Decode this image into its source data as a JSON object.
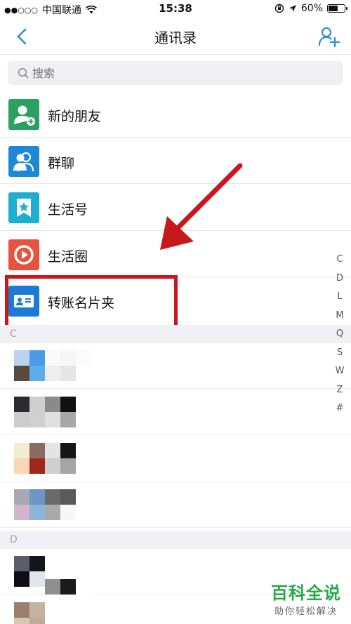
{
  "status_bar": {
    "signal": "●●○○○",
    "carrier": "中国联通",
    "time": "15:38",
    "battery_percent": "60%",
    "battery_level": 0.6
  },
  "nav": {
    "title": "通讯录"
  },
  "search": {
    "placeholder": "搜索"
  },
  "menu": [
    {
      "label": "新的朋友",
      "icon": "new-friend-icon",
      "color": "#2ba05f"
    },
    {
      "label": "群聊",
      "icon": "group-chat-icon",
      "color": "#1e88d8"
    },
    {
      "label": "生活号",
      "icon": "life-account-icon",
      "color": "#1eaed0"
    },
    {
      "label": "生活圈",
      "icon": "life-circle-icon",
      "color": "#e8533f"
    },
    {
      "label": "转账名片夹",
      "icon": "business-card-icon",
      "color": "#1b7bd6"
    }
  ],
  "sections": [
    {
      "letter": "C"
    },
    {
      "letter": "D"
    }
  ],
  "index_letters": [
    "C",
    "D",
    "L",
    "M",
    "Q",
    "S",
    "W",
    "Z",
    "#"
  ],
  "watermark": {
    "main": "百科全说",
    "sub": "助你轻松解决"
  },
  "colors": {
    "accent": "#2b8ed8",
    "highlight": "#c7181d",
    "watermark": "#27a84a"
  }
}
